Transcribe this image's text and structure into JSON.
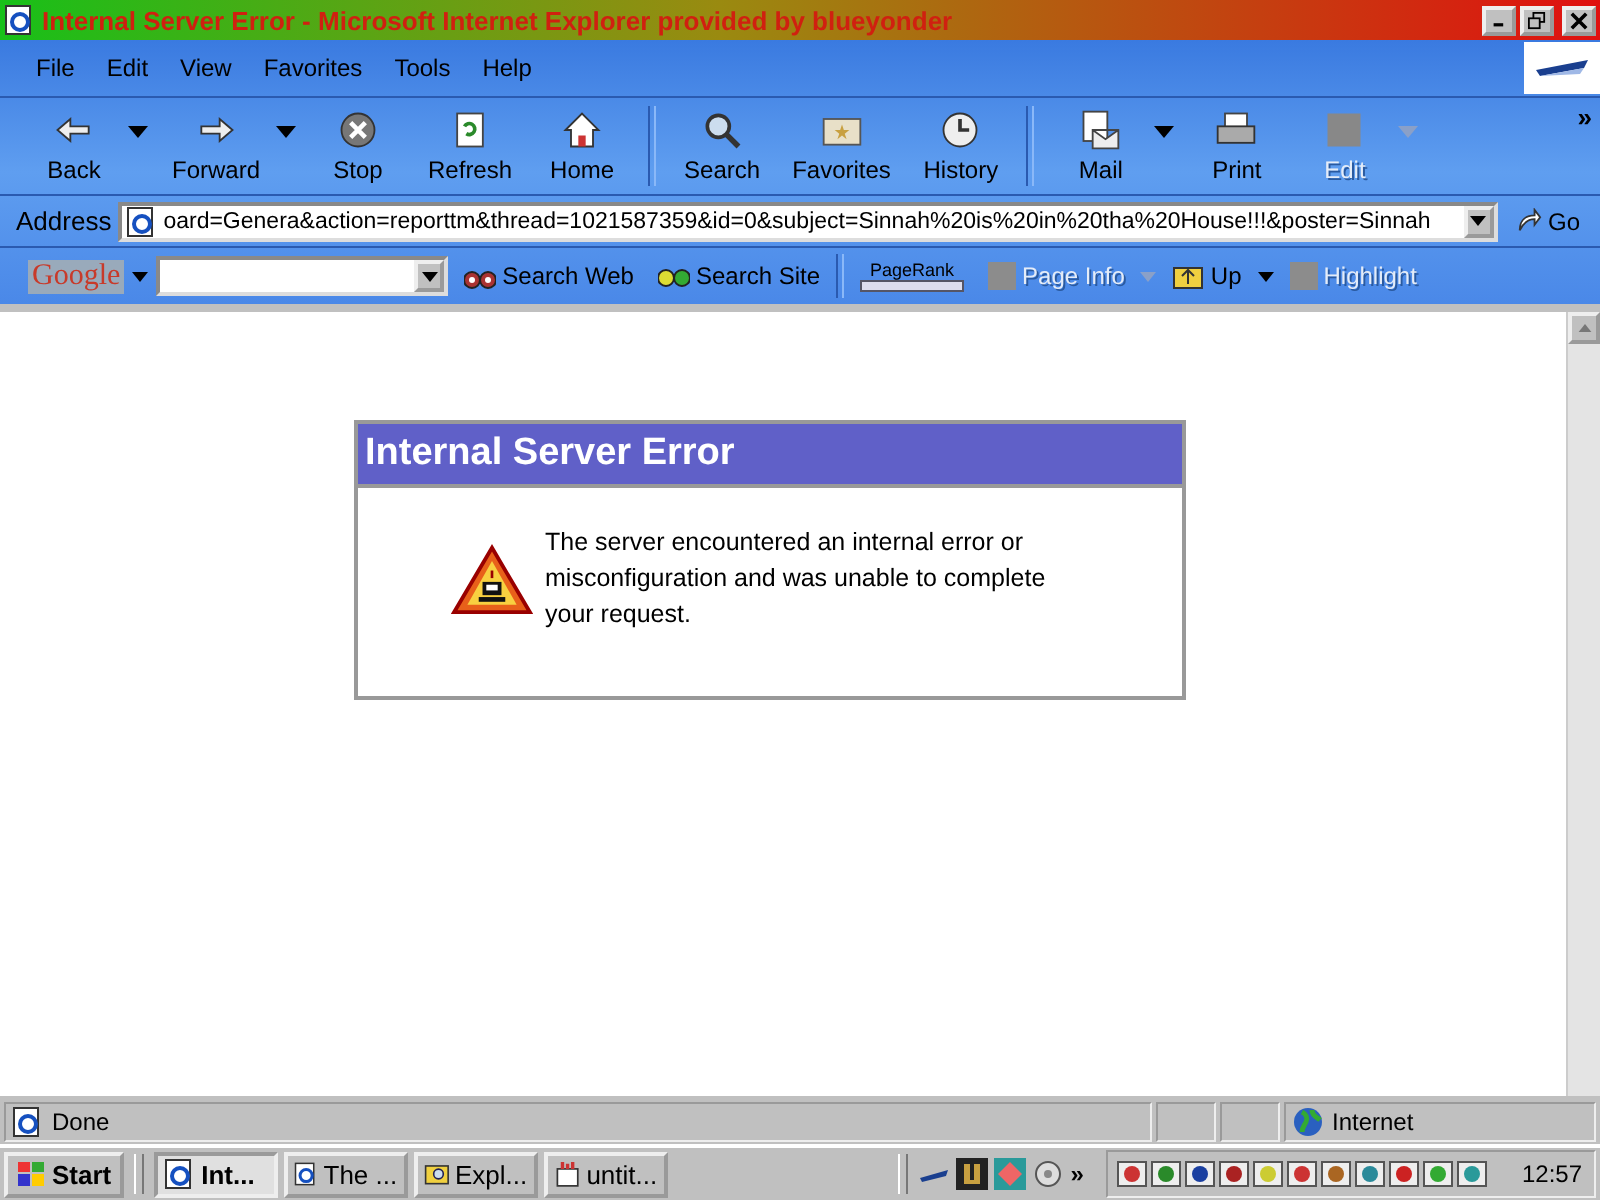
{
  "window": {
    "title": "Internal Server Error - Microsoft Internet Explorer provided by blueyonder"
  },
  "menu": [
    "File",
    "Edit",
    "View",
    "Favorites",
    "Tools",
    "Help"
  ],
  "toolbar": [
    {
      "label": "Back",
      "dropdown": true,
      "disabled": false
    },
    {
      "label": "Forward",
      "dropdown": true,
      "disabled": false
    },
    {
      "label": "Stop",
      "dropdown": false,
      "disabled": false
    },
    {
      "label": "Refresh",
      "dropdown": false,
      "disabled": false
    },
    {
      "label": "Home",
      "dropdown": false,
      "disabled": false
    },
    {
      "label": "Search",
      "dropdown": false,
      "disabled": false
    },
    {
      "label": "Favorites",
      "dropdown": false,
      "disabled": false
    },
    {
      "label": "History",
      "dropdown": false,
      "disabled": false
    },
    {
      "label": "Mail",
      "dropdown": true,
      "disabled": false
    },
    {
      "label": "Print",
      "dropdown": false,
      "disabled": false
    },
    {
      "label": "Edit",
      "dropdown": true,
      "disabled": true
    }
  ],
  "toolbar_more": "»",
  "address": {
    "label": "Address",
    "value": "oard=Genera&action=reporttm&thread=1021587359&id=0&subject=Sinnah%20is%20in%20tha%20House!!!&poster=Sinnah",
    "go": "Go"
  },
  "google_bar": {
    "logo": "Google",
    "items": [
      {
        "label": "Search Web",
        "kind": "button",
        "disabled": false,
        "dropdown": false
      },
      {
        "label": "Search Site",
        "kind": "button",
        "disabled": false,
        "dropdown": false
      },
      {
        "label": "PageRank",
        "kind": "meter"
      },
      {
        "label": "Page Info",
        "kind": "button",
        "disabled": true,
        "dropdown": true
      },
      {
        "label": "Up",
        "kind": "button",
        "disabled": false,
        "dropdown": true
      },
      {
        "label": "Highlight",
        "kind": "button",
        "disabled": true,
        "dropdown": false
      }
    ]
  },
  "error_box": {
    "title": "Internal Server Error",
    "message": "The server encountered an internal error or misconfiguration and was unable to complete your request."
  },
  "status_bar": {
    "text": "Done",
    "zone": "Internet"
  },
  "taskbar": {
    "start": "Start",
    "quick_more": "»",
    "tasks": [
      {
        "label": "Int...",
        "selected": true
      },
      {
        "label": "The ...",
        "selected": false
      },
      {
        "label": "Expl...",
        "selected": false
      },
      {
        "label": "untit...",
        "selected": false
      }
    ],
    "clock": "12:57"
  }
}
